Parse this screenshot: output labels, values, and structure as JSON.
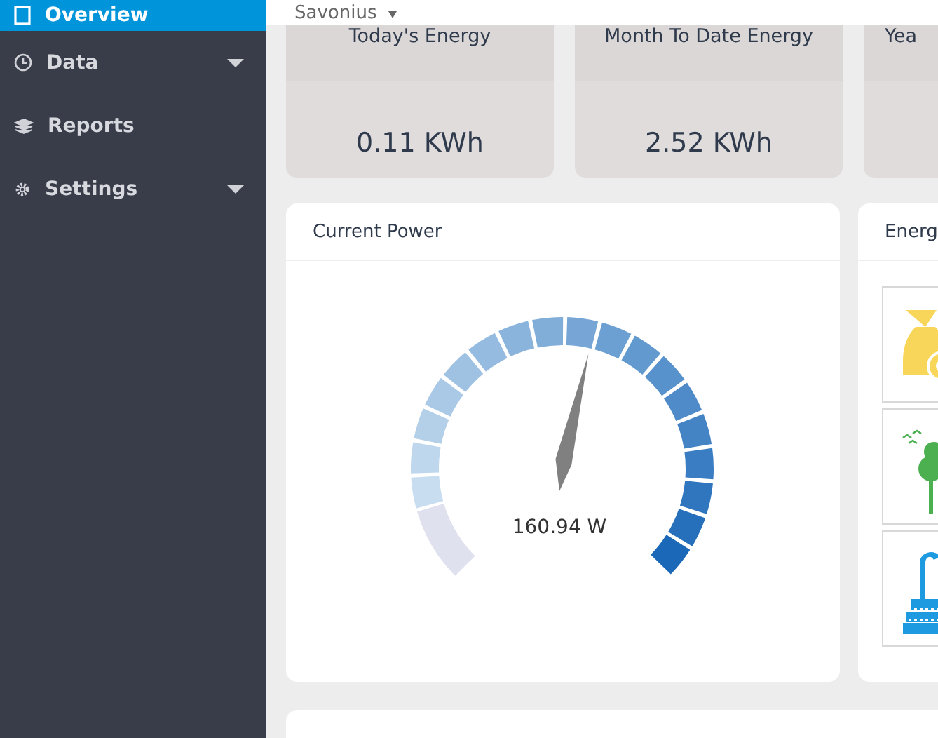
{
  "sidebar": {
    "items": [
      {
        "label": "Overview",
        "kind": "page",
        "selected": true,
        "has_submenu": false
      },
      {
        "label": "Data",
        "kind": "clock",
        "selected": false,
        "has_submenu": true
      },
      {
        "label": "Reports",
        "kind": "layers",
        "selected": false,
        "has_submenu": false
      },
      {
        "label": "Settings",
        "kind": "gear",
        "selected": false,
        "has_submenu": true
      }
    ]
  },
  "top_bar": {
    "site_selector": "Savonius"
  },
  "stats": [
    {
      "title": "Today's Energy",
      "value": "0.11 KWh"
    },
    {
      "title": "Month To Date Energy",
      "value": "2.52 KWh"
    },
    {
      "title": "Yea"
    }
  ],
  "current_power": {
    "title": "Current Power",
    "reading": "160.94 W",
    "level": 0.54
  },
  "energy_panel": {
    "title": "Energ",
    "items": [
      {
        "kind": "money"
      },
      {
        "kind": "trees"
      },
      {
        "kind": "factory"
      }
    ]
  }
}
